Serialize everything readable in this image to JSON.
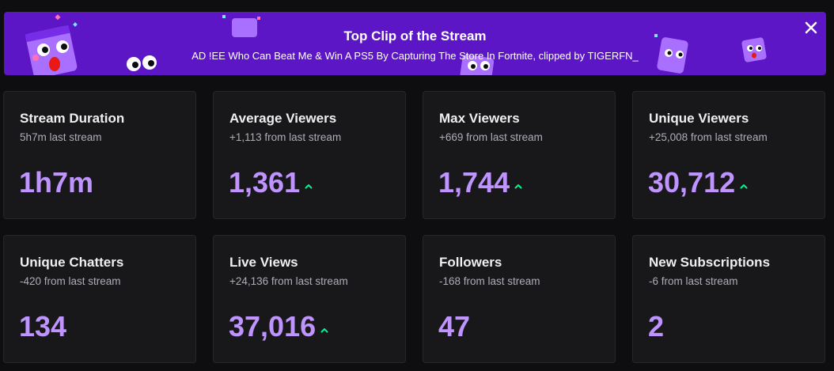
{
  "banner": {
    "title": "Top Clip of the Stream",
    "subtitle": "AD !EE Who Can Beat Me & Win A PS5 By Capturing The Store In Fortnite, clipped by TIGERFN_",
    "close_icon": "close-icon",
    "background_color": "#5c16c5"
  },
  "colors": {
    "value": "#bf94ff",
    "trend_up": "#00f593",
    "card_bg": "#18181b"
  },
  "stats": [
    {
      "title": "Stream Duration",
      "sub": "5h7m last stream",
      "value": "1h7m",
      "trend": "none"
    },
    {
      "title": "Average Viewers",
      "sub": "+1,113 from last stream",
      "value": "1,361",
      "trend": "up"
    },
    {
      "title": "Max Viewers",
      "sub": "+669 from last stream",
      "value": "1,744",
      "trend": "up"
    },
    {
      "title": "Unique Viewers",
      "sub": "+25,008 from last stream",
      "value": "30,712",
      "trend": "up"
    },
    {
      "title": "Unique Chatters",
      "sub": "-420 from last stream",
      "value": "134",
      "trend": "none"
    },
    {
      "title": "Live Views",
      "sub": "+24,136 from last stream",
      "value": "37,016",
      "trend": "up"
    },
    {
      "title": "Followers",
      "sub": "-168 from last stream",
      "value": "47",
      "trend": "none"
    },
    {
      "title": "New Subscriptions",
      "sub": "-6 from last stream",
      "value": "2",
      "trend": "none"
    }
  ]
}
